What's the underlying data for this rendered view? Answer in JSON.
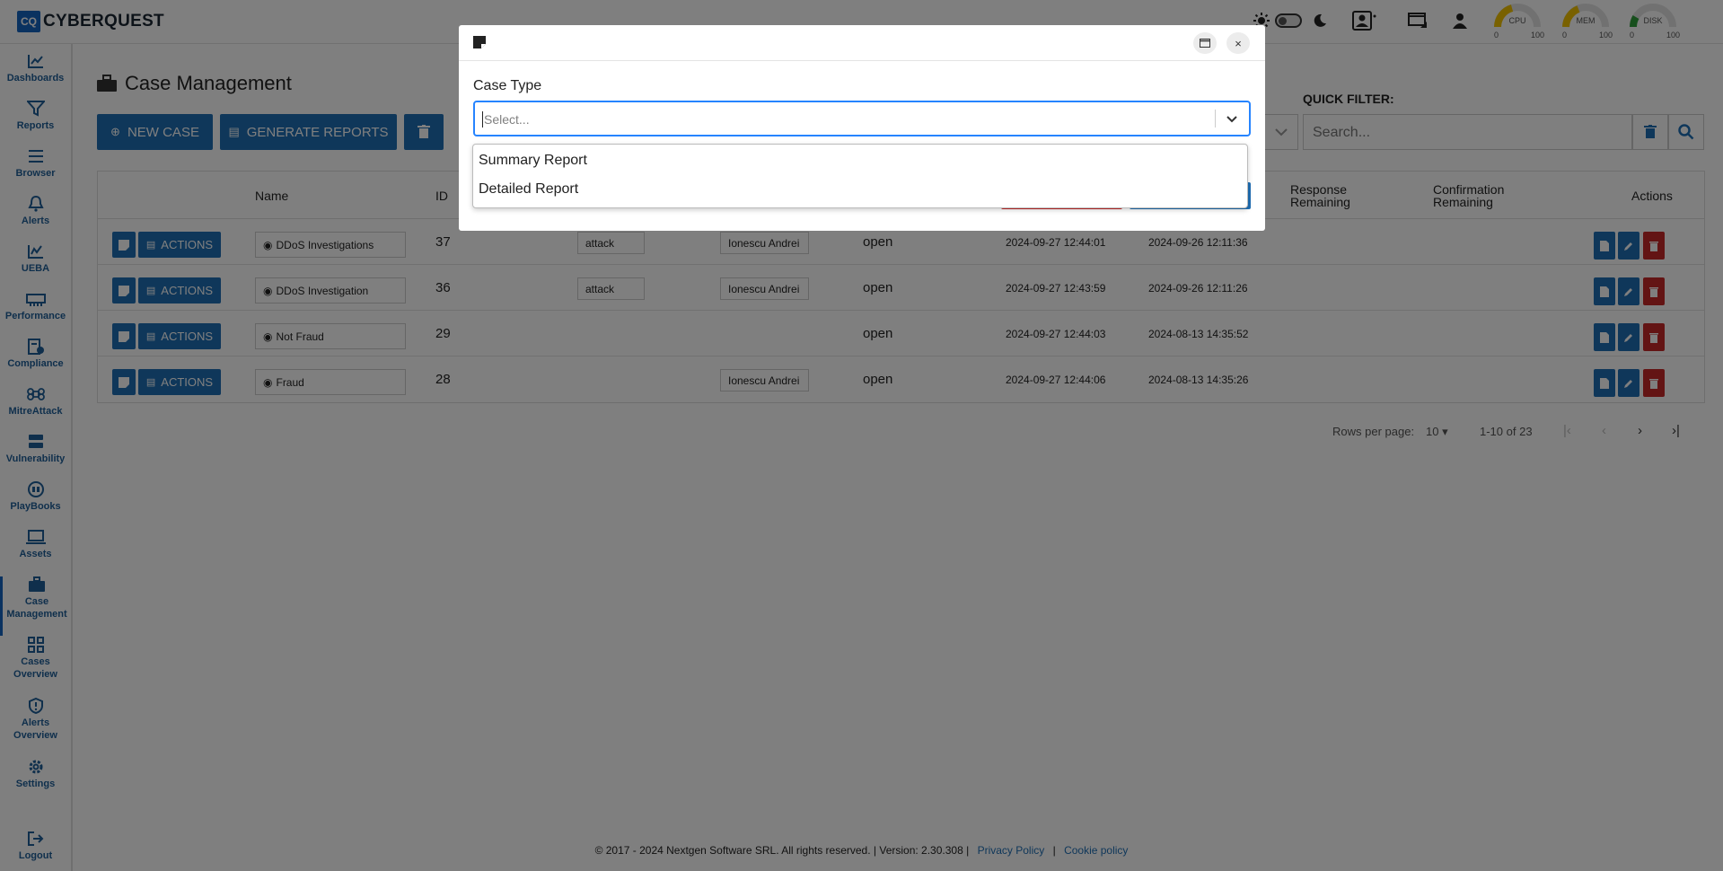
{
  "app": {
    "logo_initials": "CQ",
    "name": "CYBERQUEST"
  },
  "gauges": [
    {
      "label": "CPU",
      "min": "0",
      "max": "100"
    },
    {
      "label": "MEM",
      "min": "0",
      "max": "100"
    },
    {
      "label": "DISK",
      "min": "0",
      "max": "100"
    }
  ],
  "sidebar": {
    "items": [
      {
        "label": "Dashboards",
        "icon": "chart-icon"
      },
      {
        "label": "Reports",
        "icon": "filter-icon"
      },
      {
        "label": "Browser",
        "icon": "list-icon"
      },
      {
        "label": "Alerts",
        "icon": "bell-icon"
      },
      {
        "label": "UEBA",
        "icon": "analytics-icon"
      },
      {
        "label": "Performance",
        "icon": "memory-icon"
      },
      {
        "label": "Compliance",
        "icon": "compliance-icon"
      },
      {
        "label": "MitreAttack",
        "icon": "command-icon"
      },
      {
        "label": "Vulnerability",
        "icon": "server-icon"
      },
      {
        "label": "PlayBooks",
        "icon": "playbook-icon"
      },
      {
        "label": "Assets",
        "icon": "laptop-icon"
      },
      {
        "label_line1": "Case",
        "label_line2": "Management",
        "icon": "briefcase-icon",
        "active": true
      },
      {
        "label_line1": "Cases",
        "label_line2": "Overview",
        "icon": "grid-icon"
      },
      {
        "label_line1": "Alerts",
        "label_line2": "Overview",
        "icon": "shield-alert-icon"
      },
      {
        "label": "Settings",
        "icon": "gear-icon"
      }
    ],
    "logout": "Logout"
  },
  "page": {
    "title": "Case Management",
    "buttons": {
      "new_case": "NEW CASE",
      "generate_reports": "GENERATE REPORTS"
    },
    "quick_filter": {
      "label": "QUICK FILTER:",
      "placeholder": "Search..."
    }
  },
  "table": {
    "columns": {
      "name": "Name",
      "id": "ID",
      "response_1": "Response",
      "response_2": "Remaining",
      "confirmation_1": "Confirmation",
      "confirmation_2": "Remaining",
      "actions": "Actions"
    },
    "action_label": "ACTIONS",
    "rows": [
      {
        "name": "DDoS Investigations",
        "id": "37",
        "tag": "attack",
        "assignee": "Ionescu Andrei",
        "status": "open",
        "date1": "2024-09-27 12:44:01",
        "date2": "2024-09-26 12:11:36"
      },
      {
        "name": "DDoS Investigation",
        "id": "36",
        "tag": "attack",
        "assignee": "Ionescu Andrei",
        "status": "open",
        "date1": "2024-09-27 12:43:59",
        "date2": "2024-09-26 12:11:26"
      },
      {
        "name": "Not Fraud",
        "id": "29",
        "tag": "",
        "assignee": "",
        "status": "open",
        "date1": "2024-09-27 12:44:03",
        "date2": "2024-08-13 14:35:52"
      },
      {
        "name": "Fraud",
        "id": "28",
        "tag": "",
        "assignee": "Ionescu Andrei",
        "status": "open",
        "date1": "2024-09-27 12:44:06",
        "date2": "2024-08-13 14:35:26"
      }
    ]
  },
  "pagination": {
    "rows_label": "Rows per page:",
    "rows_value": "10",
    "range": "1-10 of 23"
  },
  "footer": {
    "text": "© 2017 - 2024 Nextgen Software SRL. All rights reserved. | Version: 2.30.308 |",
    "privacy": "Privacy Policy",
    "sep": "|",
    "cookie": "Cookie policy"
  },
  "modal": {
    "field_label": "Case Type",
    "select_placeholder": "Select...",
    "options": [
      "Summary Report",
      "Detailed Report"
    ],
    "close_glyph": "×"
  },
  "colors": {
    "primary": "#1f6fb5",
    "danger": "#c62828",
    "focus": "#2684ff"
  }
}
